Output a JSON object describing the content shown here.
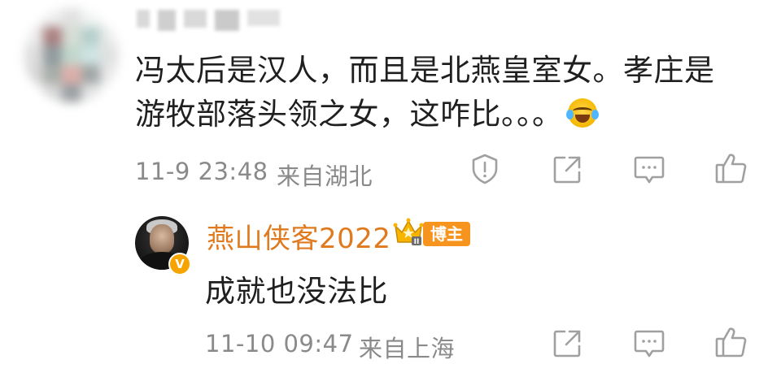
{
  "comment": {
    "text": "冯太后是汉人，而且是北燕皇室女。孝庄是游牧部落头领之女，这咋比。。。",
    "text_line1": "冯太后是汉人，而且是北燕皇室女。孝庄是",
    "text_line2": "游牧部落头领之女，这咋比。。。",
    "emoji": "laugh-cry-emoji",
    "timestamp": "11-9 23:48",
    "location": "来自湖北",
    "actions": [
      "report-icon",
      "share-icon",
      "comment-icon",
      "like-icon"
    ]
  },
  "reply": {
    "username": "燕山侠客2022",
    "badge_label": "博主",
    "verified_mark": "V",
    "crown_level": "II",
    "text": "成就也没法比",
    "timestamp": "11-10 09:47",
    "location": "来自上海",
    "actions": [
      "share-icon",
      "comment-icon",
      "like-icon"
    ]
  },
  "colors": {
    "text": "#1f1f1f",
    "meta": "#8a8a8a",
    "icon": "#a0a0a0",
    "username_orange": "#e07a1f",
    "badge_orange": "#f7941d",
    "verified_yellow": "#f7a400"
  }
}
